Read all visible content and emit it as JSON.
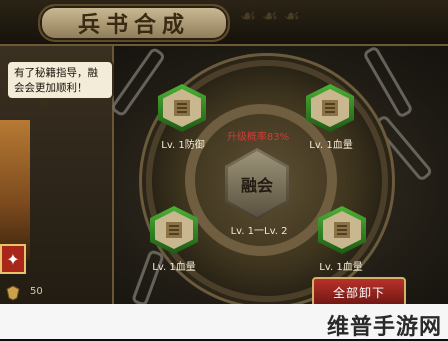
{
  "header": {
    "title": "兵书合成"
  },
  "npc": {
    "speech": "有了秘籍指导，融会会更加顺利！"
  },
  "player": {
    "level": "50"
  },
  "fusion": {
    "success_rate": "升级概率83%",
    "button_label": "融会",
    "range": "Lv. 1一Lv. 2"
  },
  "slots": [
    {
      "label": "Lv. 1防御"
    },
    {
      "label": "Lv. 1血量"
    },
    {
      "label": "Lv. 1血量"
    },
    {
      "label": "Lv. 1血量"
    }
  ],
  "actions": {
    "unload_all": "全部卸下"
  },
  "watermark": {
    "text": "维普手游网"
  },
  "colors": {
    "accent_red": "#b7322a",
    "rate_text": "#d23b36",
    "slot_green": "#4cb235"
  }
}
